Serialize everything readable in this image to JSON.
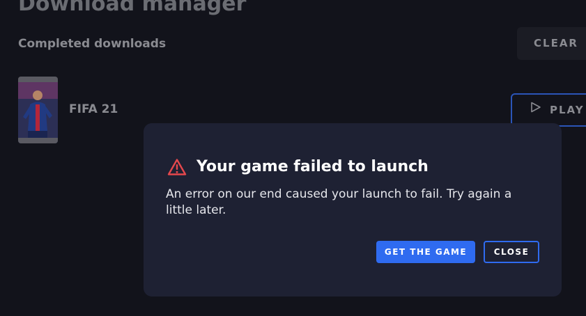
{
  "header": {
    "title": "Download manager"
  },
  "completed": {
    "section_title": "Completed downloads",
    "clear_label": "CLEAR",
    "items": [
      {
        "name": "FIFA 21",
        "action_label": "PLAY",
        "action_icon": "play-icon"
      }
    ]
  },
  "dialog": {
    "icon": "warning-icon",
    "icon_color": "#e5484d",
    "title": "Your game failed to launch",
    "message": "An error on our end caused your launch to fail. Try again a little later.",
    "primary_label": "GET THE GAME",
    "secondary_label": "CLOSE"
  },
  "colors": {
    "background": "#12131b",
    "dialog_background": "#1e2133",
    "accent": "#2f6bf0"
  }
}
